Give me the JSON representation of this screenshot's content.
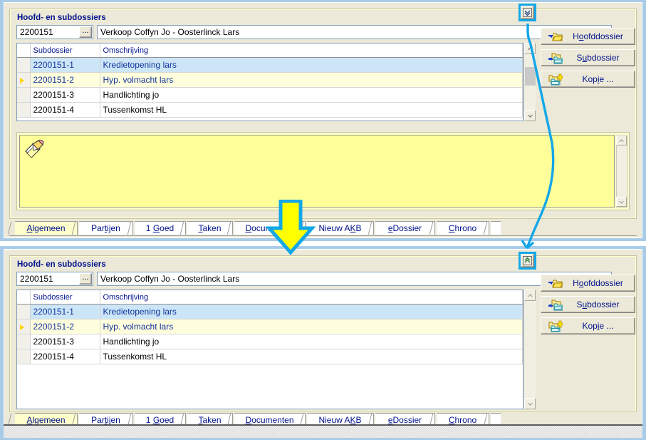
{
  "panels": [
    {
      "id": "top",
      "group_title": "Hoofd- en subdossiers",
      "dossier_id": "2200151",
      "dossier_id_browse": "...",
      "description": "Verkoop Coffyn Jo - Oosterlinck Lars",
      "columns": [
        "Subdossier",
        "Omschrijving"
      ],
      "rows": [
        {
          "subdossier": "2200151-1",
          "omschrijving": "Kredietopening  lars",
          "state": "selected"
        },
        {
          "subdossier": "2200151-2",
          "omschrijving": "Hyp. volmacht  lars",
          "state": "current"
        },
        {
          "subdossier": "2200151-3",
          "omschrijving": "Handlichting  jo",
          "state": "normal"
        },
        {
          "subdossier": "2200151-4",
          "omschrijving": "Tussenkomst HL",
          "state": "normal"
        }
      ],
      "buttons": [
        {
          "label": "Hoofddossier",
          "accel": "o",
          "icon": "folder-arrow-icon"
        },
        {
          "label": "Subdossier",
          "accel": "u",
          "icon": "folders-blue-arrow-icon"
        },
        {
          "label": "Kopie ...",
          "accel": "i",
          "icon": "folder-plus-icon"
        }
      ],
      "toggle_icon": "chevron-down-icon",
      "notes_icon": "notepad-pencil-icon",
      "notes_text": "",
      "tabs": [
        {
          "label": "Algemeen",
          "accel": "A",
          "active": true
        },
        {
          "label": "Partijen",
          "accel": "t",
          "active": false
        },
        {
          "label": "1 Goed",
          "accel": "G",
          "active": false
        },
        {
          "label": "Taken",
          "accel": "T",
          "active": false
        },
        {
          "label": "Documenten",
          "accel": "D",
          "active": false
        },
        {
          "label": "Nieuw AKB",
          "accel": "K",
          "active": false
        },
        {
          "label": "eDossier",
          "accel": "e",
          "active": false
        },
        {
          "label": "Chrono",
          "accel": "C",
          "active": false
        }
      ]
    },
    {
      "id": "bottom",
      "group_title": "Hoofd- en subdossiers",
      "dossier_id": "2200151",
      "dossier_id_browse": "...",
      "description": "Verkoop Coffyn Jo - Oosterlinck Lars",
      "columns": [
        "Subdossier",
        "Omschrijving"
      ],
      "rows": [
        {
          "subdossier": "2200151-1",
          "omschrijving": "Kredietopening  lars",
          "state": "selected"
        },
        {
          "subdossier": "2200151-2",
          "omschrijving": "Hyp. volmacht  lars",
          "state": "current"
        },
        {
          "subdossier": "2200151-3",
          "omschrijving": "Handlichting  jo",
          "state": "normal"
        },
        {
          "subdossier": "2200151-4",
          "omschrijving": "Tussenkomst HL",
          "state": "normal"
        }
      ],
      "buttons": [
        {
          "label": "Hoofddossier",
          "accel": "o",
          "icon": "folder-arrow-icon"
        },
        {
          "label": "Subdossier",
          "accel": "u",
          "icon": "folders-blue-arrow-icon"
        },
        {
          "label": "Kopie ...",
          "accel": "i",
          "icon": "folder-plus-icon"
        }
      ],
      "toggle_icon": "chevron-up-icon",
      "tabs": [
        {
          "label": "Algemeen",
          "accel": "A",
          "active": true
        },
        {
          "label": "Partijen",
          "accel": "t",
          "active": false
        },
        {
          "label": "1 Goed",
          "accel": "G",
          "active": false
        },
        {
          "label": "Taken",
          "accel": "T",
          "active": false
        },
        {
          "label": "Documenten",
          "accel": "D",
          "active": false
        },
        {
          "label": "Nieuw AKB",
          "accel": "K",
          "active": false
        },
        {
          "label": "eDossier",
          "accel": "e",
          "active": false
        },
        {
          "label": "Chrono",
          "accel": "C",
          "active": false
        }
      ]
    }
  ],
  "annotation": {
    "arrow_icon": "yellow-down-arrow",
    "callout_line_icon": "cyan-connector-line",
    "highlight_color": "#13a7e8",
    "arrow_fill": "#ffff00"
  },
  "colors": {
    "window_frame": "#a8cce8",
    "panel_face": "#ece9d8",
    "panel_yellow": "#ffffcc",
    "notes_yellow": "#ffff99",
    "row_selected": "#cde6f7",
    "row_current": "#ffffdd",
    "label_blue": "#00128c",
    "highlight_cyan": "#13a7e8"
  }
}
